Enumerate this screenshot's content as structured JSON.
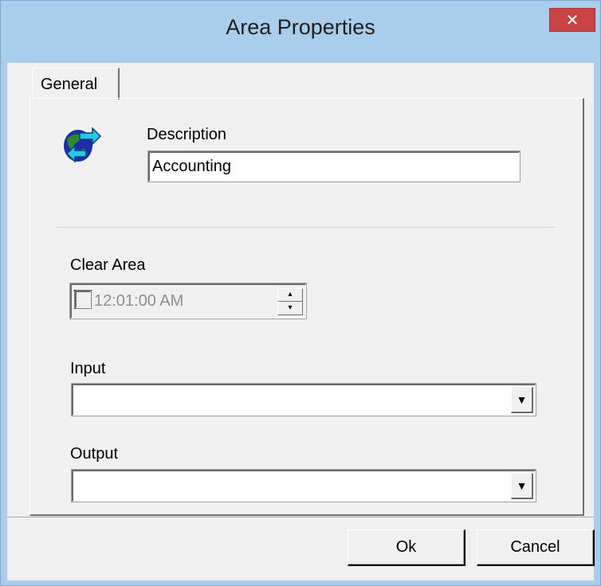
{
  "window": {
    "title": "Area Properties",
    "close_glyph": "✕"
  },
  "tabs": [
    {
      "label": "General",
      "selected": true
    }
  ],
  "general": {
    "icon": "globe-arrows-icon",
    "description": {
      "label": "Description",
      "value": "Accounting"
    },
    "clear_area": {
      "label": "Clear Area",
      "enabled": false,
      "checked": false,
      "time": "12:01:00 AM"
    },
    "input": {
      "label": "Input",
      "value": ""
    },
    "output": {
      "label": "Output",
      "value": ""
    }
  },
  "buttons": {
    "ok": "Ok",
    "cancel": "Cancel"
  },
  "colors": {
    "title_bar": "#a9cdea",
    "close_button": "#c94444",
    "dialog_face": "#f0f0f0",
    "disabled_text": "#8e8e8e"
  }
}
